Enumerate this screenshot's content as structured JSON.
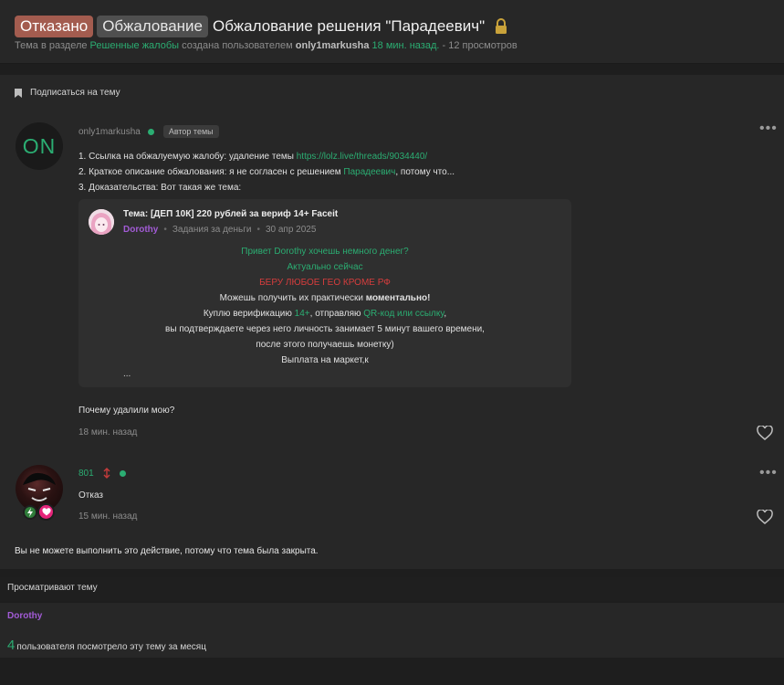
{
  "header": {
    "badge_refused": "Отказано",
    "badge_appeal": "Обжалование",
    "title": "Обжалование решения \"Парадеевич\"",
    "meta_prefix": "Тема в разделе",
    "section": "Решенные жалобы",
    "meta_mid": "создана пользователем",
    "author": "only1markusha",
    "time": "18 мин. назад.",
    "views": "- 12 просмотров",
    "lock_icon": "lock-icon"
  },
  "subscribe_label": "Подписаться на тему",
  "post1": {
    "avatar_text": "ON",
    "username": "only1markusha",
    "author_badge": "Автор темы",
    "line1_prefix": "1. Ссылка на обжалуемую жалобу: удаление темы",
    "line1_link": "https://lolz.live/threads/9034440/",
    "line2_prefix": "2. Краткое описание обжалования: я не согласен с решением",
    "line2_user": "Парадеевич",
    "line2_suffix": ", потому что...",
    "line3": "3. Доказательства: Вот такая же тема:",
    "quote": {
      "title": "Тема: [ДЕП 10К] 220 рублей за вериф 14+ Faceit",
      "author": "Dorothy",
      "category": "Задания за деньги",
      "date": "30 апр 2025",
      "l1": "Привет Dorothy хочешь немного денег?",
      "l2": "Актуально сейчас",
      "l3": "БЕРУ ЛЮБОЕ ГЕО КРОМЕ РФ",
      "l4a": "Можешь получить их практически",
      "l4b": "моментально!",
      "l5a": "Куплю верификацию",
      "l5b": "14+",
      "l5c": ", отправляю",
      "l5d": "QR-код или ссылку",
      "l5e": ",",
      "l6": "вы подтверждаете через него личность занимает 5 минут вашего времени,",
      "l7": "после этого получаешь монетку)",
      "l8": "Выплата на маркет,к",
      "ellipsis": "..."
    },
    "closing": "Почему удалили мою?",
    "time": "18 мин. назад"
  },
  "post2": {
    "username": "801",
    "text": "Отказ",
    "time": "15 мин. назад"
  },
  "closed_message": "Вы не можете выполнить это действие, потому что тема была закрыта.",
  "viewing": {
    "header": "Просматривают тему",
    "user": "Dorothy",
    "count": "4",
    "count_label": "пользователя посмотрело эту тему за месяц"
  },
  "colors": {
    "accent_green": "#2bad72",
    "refused": "#a35c4f",
    "purple": "#a25bd6",
    "red": "#d63d3d"
  }
}
